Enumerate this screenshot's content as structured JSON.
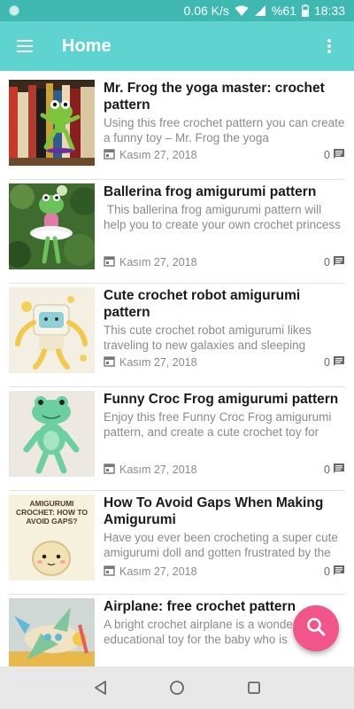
{
  "status": {
    "speed": "0.06 K/s",
    "battery": "%61",
    "time": "18:33"
  },
  "app_bar": {
    "title": "Home"
  },
  "colors": {
    "app_bar": "#5ed3cf",
    "status_bar": "#3fb8b1",
    "fab": "#f2558a"
  },
  "posts": [
    {
      "title": "Mr. Frog the yoga master: crochet pattern",
      "excerpt": "Using this free crochet pattern you can create a funny toy – Mr. Frog the yoga",
      "date": "Kasım 27, 2018",
      "comments": "0"
    },
    {
      "title": "Ballerina frog amigurumi pattern",
      "excerpt": " This ballerina frog amigurumi pattern will help you to create your own crochet princess",
      "date": "Kasım 27, 2018",
      "comments": "0"
    },
    {
      "title": "Cute crochet robot amigurumi pattern",
      "excerpt": "This cute crochet robot amigurumi likes traveling to new galaxies and sleeping",
      "date": "Kasım 27, 2018",
      "comments": "0"
    },
    {
      "title": "Funny Croc Frog amigurumi pattern",
      "excerpt": "Enjoy this free Funny Croc Frog amigurumi pattern, and create a cute crochet toy for",
      "date": "Kasım 27, 2018",
      "comments": "0"
    },
    {
      "title": "How To Avoid Gaps When Making Amigurumi",
      "excerpt": "Have you ever been crocheting a super cute amigurumi doll and gotten frustrated by the",
      "date": "Kasım 27, 2018",
      "comments": "0",
      "thumb_text": "AMIGURUMI CROCHET: HOW TO AVOID GAPS?"
    },
    {
      "title": "Airplane: free crochet pattern",
      "excerpt": "A bright crochet airplane is a wonderful educational toy for the baby who is",
      "date": "",
      "comments": ""
    }
  ]
}
